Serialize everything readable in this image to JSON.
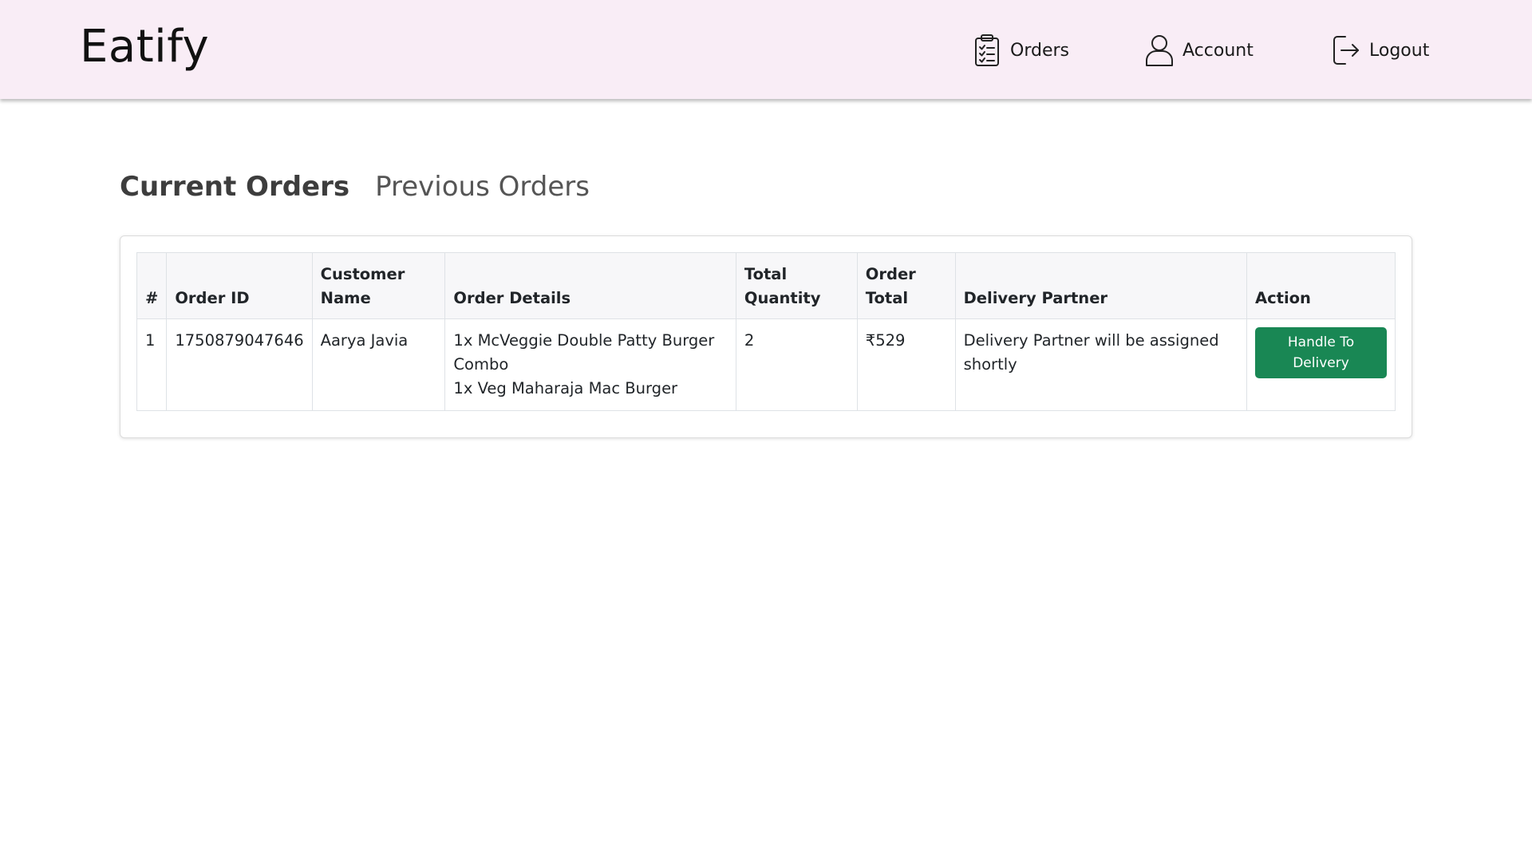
{
  "brand": "Eatify",
  "nav": {
    "orders": {
      "label": "Orders",
      "icon": "clipboard-list-icon"
    },
    "account": {
      "label": "Account",
      "icon": "user-icon"
    },
    "logout": {
      "label": "Logout",
      "icon": "logout-icon"
    }
  },
  "tabs": {
    "current": "Current Orders",
    "previous": "Previous Orders"
  },
  "table": {
    "headers": {
      "index": "#",
      "order_id": "Order ID",
      "customer_name": "Customer Name",
      "order_details": "Order Details",
      "total_quantity": "Total Quantity",
      "order_total": "Order Total",
      "delivery_partner": "Delivery Partner",
      "action": "Action"
    },
    "rows": [
      {
        "index": "1",
        "order_id": "1750879047646",
        "customer_name": "Aarya Javia",
        "order_details": [
          "1x McVeggie Double Patty Burger Combo",
          "1x Veg Maharaja Mac Burger"
        ],
        "total_quantity": "2",
        "order_total": "₹529",
        "delivery_partner": "Delivery Partner will be assigned shortly",
        "action": "Handle To Delivery"
      }
    ]
  },
  "colors": {
    "navbar_bg": "#f9edf6",
    "action_button": "#198754"
  }
}
